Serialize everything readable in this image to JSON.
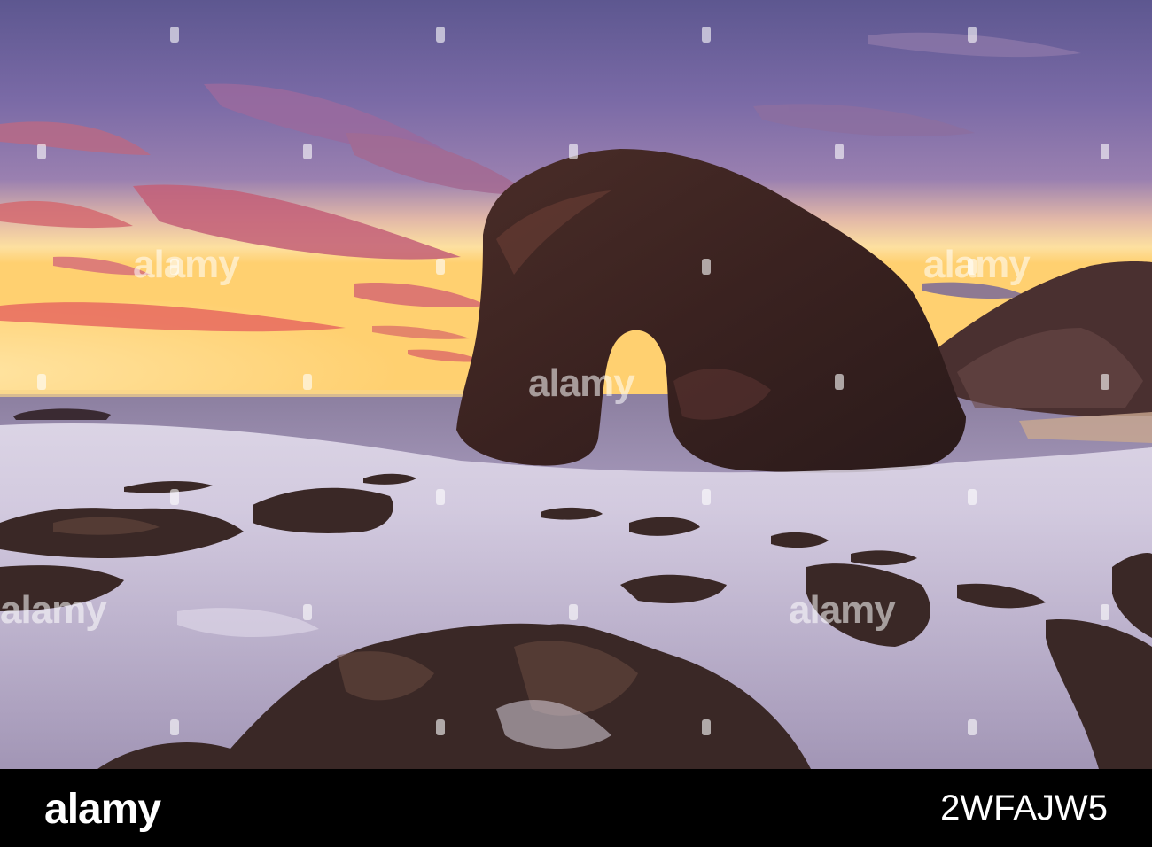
{
  "watermark": {
    "brand": "alamy"
  },
  "footer": {
    "logo": "alamy",
    "image_code": "2WFAJW5"
  }
}
